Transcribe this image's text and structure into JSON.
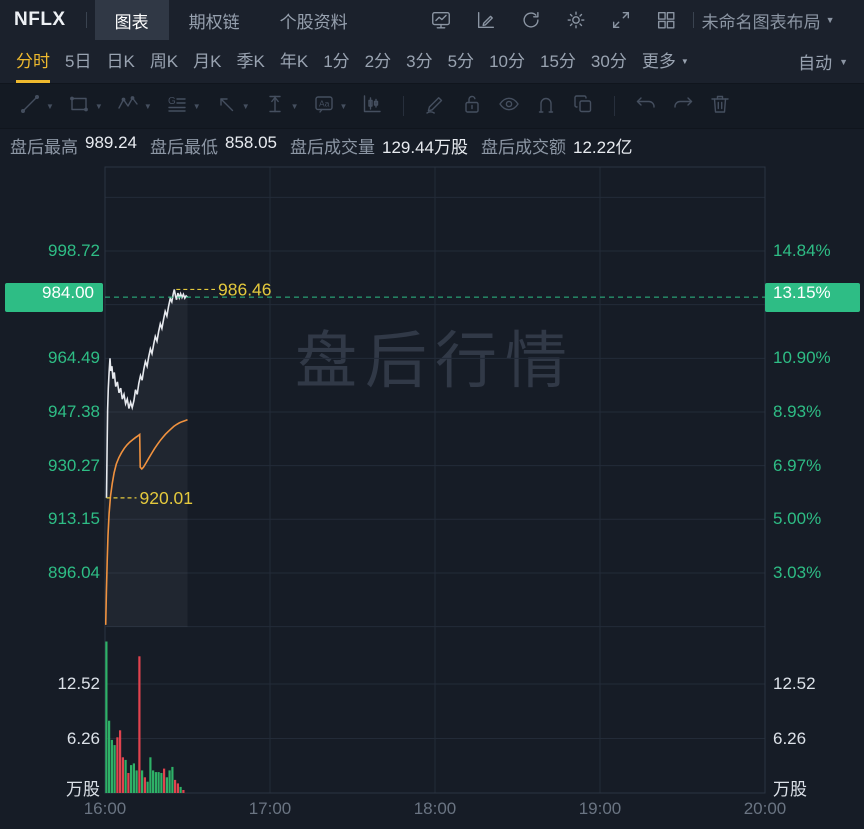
{
  "header": {
    "symbol": "NFLX",
    "tabs": [
      {
        "name": "tab-chart",
        "label": "图表",
        "active": true
      },
      {
        "name": "tab-option-chain",
        "label": "期权链",
        "active": false
      },
      {
        "name": "tab-stock-info",
        "label": "个股资料",
        "active": false
      }
    ],
    "icons": [
      "chart-monitor-icon",
      "edit-chart-icon",
      "refresh-icon",
      "settings-icon",
      "fullscreen-icon",
      "layout-grid-icon"
    ],
    "layout_menu": "未命名图表布局"
  },
  "timeframe": {
    "items": [
      {
        "name": "tf-intraday",
        "label": "分时",
        "active": true
      },
      {
        "name": "tf-5d",
        "label": "5日"
      },
      {
        "name": "tf-day",
        "label": "日K"
      },
      {
        "name": "tf-week",
        "label": "周K"
      },
      {
        "name": "tf-month",
        "label": "月K"
      },
      {
        "name": "tf-quarter",
        "label": "季K"
      },
      {
        "name": "tf-year",
        "label": "年K"
      },
      {
        "name": "tf-1m",
        "label": "1分"
      },
      {
        "name": "tf-2m",
        "label": "2分"
      },
      {
        "name": "tf-3m",
        "label": "3分"
      },
      {
        "name": "tf-5m",
        "label": "5分"
      },
      {
        "name": "tf-10m",
        "label": "10分"
      },
      {
        "name": "tf-15m",
        "label": "15分"
      },
      {
        "name": "tf-30m",
        "label": "30分"
      },
      {
        "name": "tf-more",
        "label": "更多",
        "caret": true
      }
    ],
    "right": {
      "label": "自动",
      "caret": true
    }
  },
  "drawing_toolbar": {
    "groups": [
      {
        "icons": [
          {
            "name": "trend-line-icon",
            "caret": true
          },
          {
            "name": "rectangle-icon",
            "caret": true
          },
          {
            "name": "wave-icon",
            "caret": true
          },
          {
            "name": "gann-icon",
            "caret": true
          },
          {
            "name": "arrow-icon",
            "caret": true
          },
          {
            "name": "price-range-icon",
            "caret": true
          },
          {
            "name": "text-label-icon",
            "caret": true
          },
          {
            "name": "candle-pattern-icon",
            "caret": false
          }
        ]
      },
      {
        "icons": [
          {
            "name": "brush-icon"
          },
          {
            "name": "unlock-icon"
          },
          {
            "name": "visibility-icon"
          },
          {
            "name": "magnet-icon"
          },
          {
            "name": "duplicate-icon"
          }
        ]
      },
      {
        "icons": [
          {
            "name": "undo-icon"
          },
          {
            "name": "redo-icon"
          },
          {
            "name": "trash-icon"
          }
        ]
      }
    ]
  },
  "stats": [
    {
      "name": "after-hours-high",
      "label": "盘后最高",
      "value": "989.24"
    },
    {
      "name": "after-hours-low",
      "label": "盘后最低",
      "value": "858.05"
    },
    {
      "name": "after-hours-volume",
      "label": "盘后成交量",
      "value": "129.44万股"
    },
    {
      "name": "after-hours-turnover",
      "label": "盘后成交额",
      "value": "12.22亿"
    }
  ],
  "chart_data": {
    "type": "line",
    "title": "NFLX 分时 盘后行情 (after-hours intraday line with volume)",
    "watermark": "盘后行情",
    "x_ticks": [
      "16:00",
      "17:00",
      "18:00",
      "19:00",
      "20:00"
    ],
    "x_span_minutes": 240,
    "price_ticks": [
      {
        "value": 998.72,
        "label": "998.72",
        "pct": "14.84%"
      },
      {
        "value": 964.49,
        "label": "964.49",
        "pct": "10.90%"
      },
      {
        "value": 947.38,
        "label": "947.38",
        "pct": "8.93%"
      },
      {
        "value": 930.27,
        "label": "930.27",
        "pct": "6.97%"
      },
      {
        "value": 913.15,
        "label": "913.15",
        "pct": "5.00%"
      },
      {
        "value": 896.04,
        "label": "896.04",
        "pct": "3.03%"
      }
    ],
    "current": {
      "value": 984.0,
      "label": "984.00",
      "pct": "13.15%"
    },
    "high_marker": {
      "value": 986.46,
      "label": "986.46"
    },
    "low_marker": {
      "value": 920.01,
      "label": "920.01"
    },
    "volume_ticks": [
      {
        "value": 12.52,
        "label": "12.52"
      },
      {
        "value": 6.26,
        "label": "6.26"
      }
    ],
    "volume_unit": "万股",
    "price_line": [
      [
        0.55,
        920.01
      ],
      [
        0.75,
        936
      ],
      [
        0.95,
        948
      ],
      [
        1.2,
        955
      ],
      [
        1.5,
        960
      ],
      [
        1.8,
        964.5
      ],
      [
        2.1,
        960.5
      ],
      [
        2.5,
        962
      ],
      [
        2.9,
        958
      ],
      [
        3.4,
        960
      ],
      [
        3.9,
        955.5
      ],
      [
        4.5,
        957
      ],
      [
        5.1,
        953.5
      ],
      [
        5.7,
        955
      ],
      [
        6.3,
        951.5
      ],
      [
        6.9,
        953
      ],
      [
        7.5,
        950
      ],
      [
        8.1,
        951.5
      ],
      [
        8.7,
        948.5
      ],
      [
        9.3,
        950.5
      ],
      [
        9.9,
        948.8
      ],
      [
        10.5,
        951
      ],
      [
        11.1,
        954.5
      ],
      [
        11.7,
        953
      ],
      [
        12.3,
        956.5
      ],
      [
        12.9,
        959
      ],
      [
        13.5,
        957.5
      ],
      [
        14.1,
        961
      ],
      [
        14.7,
        963.5
      ],
      [
        15.3,
        962
      ],
      [
        15.9,
        965
      ],
      [
        16.5,
        967.5
      ],
      [
        17.1,
        966
      ],
      [
        17.7,
        969
      ],
      [
        18.3,
        971.5
      ],
      [
        18.9,
        970
      ],
      [
        19.5,
        973
      ],
      [
        20.1,
        975.5
      ],
      [
        20.7,
        974
      ],
      [
        21.3,
        977
      ],
      [
        21.9,
        979.5
      ],
      [
        22.5,
        978
      ],
      [
        23.1,
        981
      ],
      [
        23.7,
        983.5
      ],
      [
        24.3,
        982.5
      ],
      [
        24.8,
        985
      ],
      [
        25.2,
        986.46
      ],
      [
        25.6,
        984.6
      ],
      [
        26.0,
        983.2
      ],
      [
        26.5,
        985.3
      ],
      [
        27.0,
        983.8
      ],
      [
        27.5,
        985.1
      ],
      [
        28.0,
        983.9
      ],
      [
        28.5,
        984.9
      ],
      [
        29.0,
        983.7
      ],
      [
        29.5,
        984.4
      ],
      [
        30.0,
        984.0
      ]
    ],
    "avg_line": [
      [
        0.25,
        879.5
      ],
      [
        0.5,
        890
      ],
      [
        0.8,
        900
      ],
      [
        1.1,
        908
      ],
      [
        1.5,
        915
      ],
      [
        2,
        920.5
      ],
      [
        2.6,
        924.5
      ],
      [
        3.3,
        928
      ],
      [
        4.1,
        930.8
      ],
      [
        5,
        932.8
      ],
      [
        6,
        934.4
      ],
      [
        7,
        935.8
      ],
      [
        8,
        936.9
      ],
      [
        9,
        937.8
      ],
      [
        10,
        938.5
      ],
      [
        11,
        939.2
      ],
      [
        12,
        939.8
      ],
      [
        12.6,
        940.2
      ],
      [
        12.8,
        929.8
      ],
      [
        13.4,
        929.2
      ],
      [
        14,
        929.8
      ],
      [
        15,
        931.3
      ],
      [
        16,
        932.8
      ],
      [
        17,
        934.3
      ],
      [
        18,
        935.7
      ],
      [
        19,
        937
      ],
      [
        20,
        938.2
      ],
      [
        21,
        939.3
      ],
      [
        22,
        940.3
      ],
      [
        23,
        941.2
      ],
      [
        24,
        942
      ],
      [
        25,
        942.8
      ],
      [
        26,
        943.4
      ],
      [
        27,
        943.9
      ],
      [
        28,
        944.3
      ],
      [
        29,
        944.6
      ],
      [
        30,
        944.9
      ]
    ],
    "volume_bars": [
      [
        0.5,
        17.4,
        "g"
      ],
      [
        1.5,
        8.3,
        "g"
      ],
      [
        2.5,
        6.1,
        "g"
      ],
      [
        3.5,
        5.5,
        "g"
      ],
      [
        4.5,
        6.4,
        "r"
      ],
      [
        5.5,
        7.2,
        "r"
      ],
      [
        6.5,
        4.1,
        "r"
      ],
      [
        7.5,
        3.8,
        "g"
      ],
      [
        8.5,
        2.3,
        "r"
      ],
      [
        9.5,
        3.2,
        "g"
      ],
      [
        10.5,
        3.4,
        "g"
      ],
      [
        11.5,
        2.6,
        "g"
      ],
      [
        12.5,
        15.7,
        "r"
      ],
      [
        13.5,
        2.6,
        "g"
      ],
      [
        14.5,
        1.8,
        "r"
      ],
      [
        15.5,
        1.3,
        "g"
      ],
      [
        16.5,
        4.1,
        "g"
      ],
      [
        17.5,
        2.6,
        "g"
      ],
      [
        18.5,
        2.4,
        "g"
      ],
      [
        19.5,
        2.4,
        "g"
      ],
      [
        20.5,
        2.3,
        "g"
      ],
      [
        21.5,
        2.8,
        "r"
      ],
      [
        22.5,
        1.8,
        "g"
      ],
      [
        23.5,
        2.6,
        "g"
      ],
      [
        24.5,
        3.0,
        "g"
      ],
      [
        25.5,
        1.5,
        "r"
      ],
      [
        26.5,
        1.1,
        "r"
      ],
      [
        27.5,
        0.7,
        "g"
      ],
      [
        28.5,
        0.35,
        "r"
      ]
    ],
    "colors": {
      "up": "#2ebd85",
      "down": "#e0434e",
      "vol_up": "#2eb167",
      "vol_down": "#e0434e",
      "avg": "#f0923f",
      "line": "#e6e9ee",
      "marker": "#e4c93d",
      "grid": "#232b38",
      "border": "#2b3442"
    }
  }
}
